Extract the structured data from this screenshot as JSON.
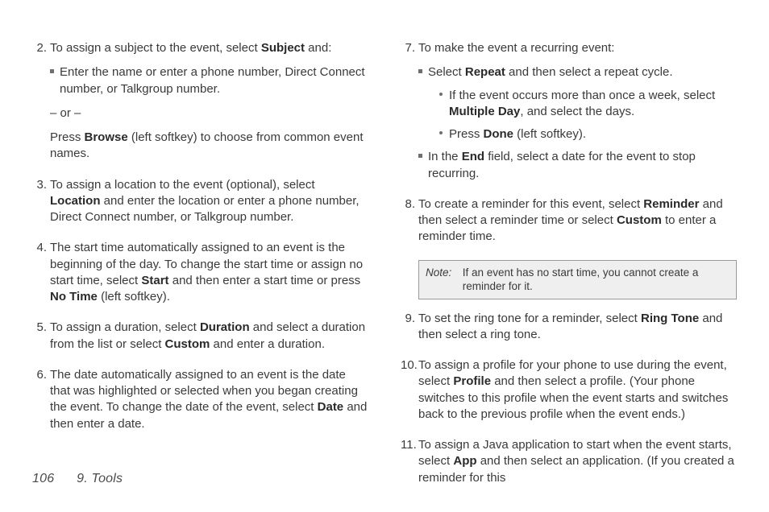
{
  "footer": {
    "page_no": "106",
    "section": "9. Tools"
  },
  "labels": {
    "subject": "Subject",
    "browse": "Browse",
    "location": "Location",
    "start": "Start",
    "notime": "No Time",
    "duration": "Duration",
    "custom": "Custom",
    "date": "Date",
    "repeat": "Repeat",
    "multiple_day": "Multiple Day",
    "done": "Done",
    "end": "End",
    "reminder": "Reminder",
    "ringtone": "Ring Tone",
    "profile": "Profile",
    "app": "App"
  },
  "left": {
    "s2": {
      "num": "2.",
      "intro_a": "To assign a subject to the event, select ",
      "intro_b": " and:",
      "bullet1": "Enter the name or enter a phone number, Direct Connect number, or Talkgroup number.",
      "or": "– or –",
      "browse_a": "Press ",
      "browse_b": " (left softkey) to choose from common event names."
    },
    "s3": {
      "num": "3.",
      "a": "To assign a location to the event (optional), select ",
      "b": " and enter the location or enter a phone number, Direct Connect number, or Talkgroup number."
    },
    "s4": {
      "num": "4.",
      "a": "The start time automatically assigned to an event is the beginning of the day. To change the start time or assign no start time, select ",
      "b": " and then enter a start time or press ",
      "c": " (left softkey)."
    },
    "s5": {
      "num": "5.",
      "a": "To assign a duration, select ",
      "b": " and select a duration from the list or select ",
      "c": " and enter a duration."
    },
    "s6": {
      "num": "6.",
      "a": "The date automatically assigned to an event is the date that was highlighted or selected when you began creating the event. To change the date of the event, select ",
      "b": " and then enter a date."
    }
  },
  "right": {
    "s7": {
      "num": "7.",
      "intro": "To make the event a recurring event:",
      "b1a": "Select ",
      "b1b": " and then select a repeat cycle.",
      "b1_1a": "If the event occurs more than once a week, select ",
      "b1_1b": ", and select the days.",
      "b1_2a": "Press ",
      "b1_2b": " (left softkey).",
      "b2a": "In the ",
      "b2b": " field, select a date for the event to stop recurring."
    },
    "s8": {
      "num": "8.",
      "a": "To create a reminder for this event, select ",
      "b": " and then select a reminder time or select ",
      "c": " to enter a reminder time."
    },
    "note": {
      "label": "Note:",
      "text": "If an event has no start time, you cannot create a reminder for it."
    },
    "s9": {
      "num": "9.",
      "a": "To set the ring tone for a reminder, select ",
      "b": " and then select a ring tone."
    },
    "s10": {
      "num": "10.",
      "a": "To assign a profile for your phone to use during the event, select ",
      "b": " and then select a profile. (Your phone switches to this profile when the event starts and switches back to the previous profile when the event ends.)"
    },
    "s11": {
      "num": "11.",
      "a": "To assign a Java application to start when the event starts, select ",
      "b": " and then select an application. (If you created a reminder for this"
    }
  }
}
